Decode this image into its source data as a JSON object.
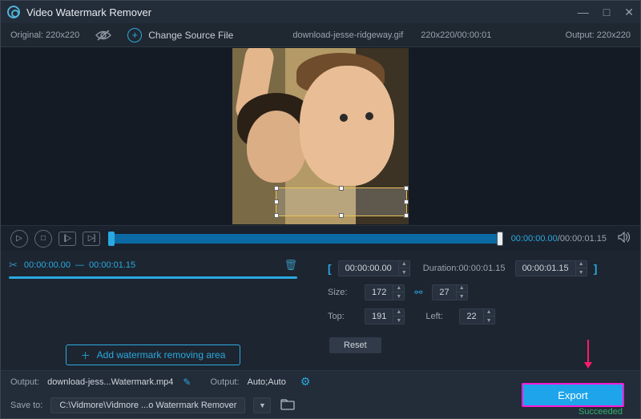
{
  "titlebar": {
    "app_title": "Video Watermark Remover"
  },
  "sourcebar": {
    "original_label": "Original:",
    "original_dims": "220x220",
    "change_source": "Change Source File",
    "filename": "download-jesse-ridgeway.gif",
    "src_dims_time": "220x220/00:00:01",
    "output_label": "Output:",
    "output_dims": "220x220"
  },
  "transport": {
    "current": "00:00:00.00",
    "total": "00:00:01.15"
  },
  "segment": {
    "start": "00:00:00.00",
    "end": "00:00:01.15"
  },
  "controls": {
    "range_start": "00:00:00.00",
    "duration_label": "Duration:",
    "duration_value": "00:00:01.15",
    "range_end": "00:00:01.15",
    "size_label": "Size:",
    "size_w": "172",
    "size_h": "27",
    "top_label": "Top:",
    "top_v": "191",
    "left_label": "Left:",
    "left_v": "22",
    "reset": "Reset"
  },
  "add_area_label": "Add watermark removing area",
  "bottom1": {
    "output_label": "Output:",
    "output_file": "download-jess...Watermark.mp4",
    "output2_label": "Output:",
    "output2_value": "Auto;Auto"
  },
  "bottom2": {
    "saveto_label": "Save to:",
    "saveto_path": "C:\\Vidmore\\Vidmore ...o Watermark Remover"
  },
  "export_label": "Export",
  "status": "Succeeded"
}
